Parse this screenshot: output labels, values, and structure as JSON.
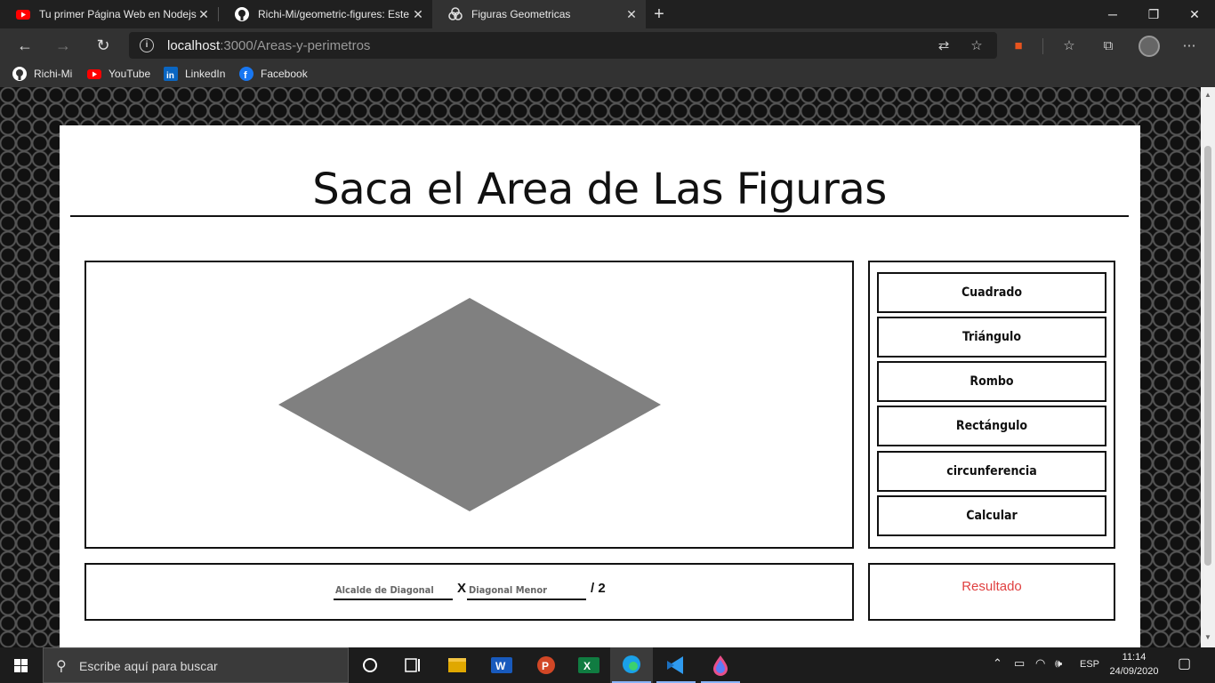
{
  "browser": {
    "tabs": [
      {
        "title": "Tu primer Página Web en Nodejs",
        "icon": "youtube-icon",
        "active": false
      },
      {
        "title": "Richi-Mi/geometric-figures: Este",
        "icon": "github-icon",
        "active": false
      },
      {
        "title": "Figuras Geometricas",
        "icon": "app-icon",
        "active": true
      }
    ],
    "url_host": "localhost",
    "url_rest": ":3000/Areas-y-perimetros",
    "bookmarks": [
      {
        "label": "Richi-Mi",
        "icon": "github-icon"
      },
      {
        "label": "YouTube",
        "icon": "youtube-icon"
      },
      {
        "label": "LinkedIn",
        "icon": "linkedin-icon"
      },
      {
        "label": "Facebook",
        "icon": "facebook-icon"
      }
    ]
  },
  "page": {
    "title": "Saca el Area de Las Figuras",
    "figure": {
      "shape": "rombo",
      "fill": "#808080"
    },
    "menu": [
      "Cuadrado",
      "Triángulo",
      "Rombo",
      "Rectángulo",
      "circunferencia",
      "Calcular"
    ],
    "formula": {
      "input1_placeholder": "Alcalde de Diagonal",
      "operator": "X",
      "input2_placeholder": "Diagonal Menor",
      "suffix": "/ 2"
    },
    "result": "Resultado"
  },
  "taskbar": {
    "search_placeholder": "Escribe aquí para buscar",
    "language": "ESP",
    "time": "11:14",
    "date": "24/09/2020"
  },
  "colors": {
    "result_text": "#e04040",
    "chrome_bg": "#202020",
    "tab_active": "#323232"
  }
}
